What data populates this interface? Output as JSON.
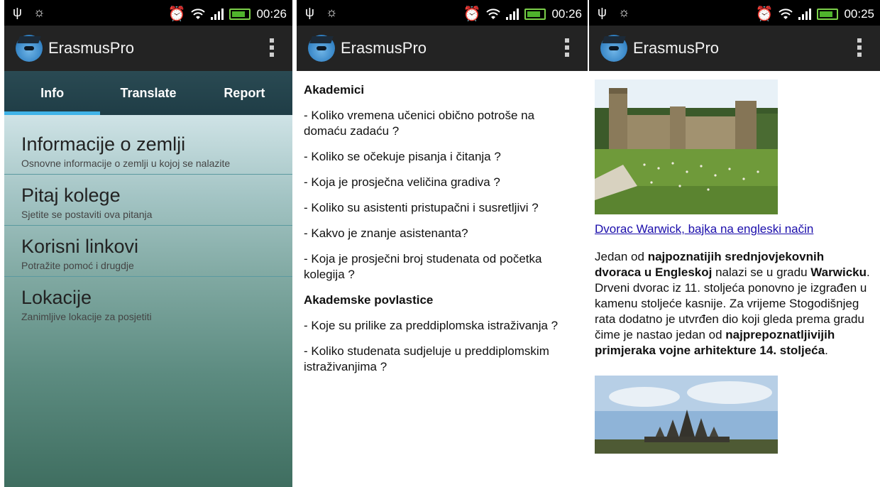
{
  "status_bars": [
    {
      "time": "00:26"
    },
    {
      "time": "00:26"
    },
    {
      "time": "00:25"
    }
  ],
  "app": {
    "title": "ErasmusPro"
  },
  "screen1": {
    "tabs": [
      {
        "label": "Info",
        "active": true
      },
      {
        "label": "Translate",
        "active": false
      },
      {
        "label": "Report",
        "active": false
      }
    ],
    "items": [
      {
        "title": "Informacije o zemlji",
        "subtitle": "Osnovne informacije o zemlji u kojoj se nalazite"
      },
      {
        "title": "Pitaj kolege",
        "subtitle": "Sjetite se postaviti ova pitanja"
      },
      {
        "title": "Korisni linkovi",
        "subtitle": "Potražite pomoć i drugdje"
      },
      {
        "title": "Lokacije",
        "subtitle": "Zanimljive lokacije za posjetiti"
      }
    ]
  },
  "screen2": {
    "heading1": "Akademici",
    "questions1": [
      "- Koliko vremena učenici obično potroše na domaću zadaću ?",
      "- Koliko se očekuje pisanja i čitanja ?",
      "- Koja je prosječna veličina gradiva ?",
      "- Koliko su asistenti pristupačni i susretljivi ?",
      "- Kakvo je znanje asistenanta?",
      "- Koja je prosječni broj studenata od početka kolegija ?"
    ],
    "heading2": "Akademske povlastice",
    "questions2": [
      "- Koje su prilike za preddiplomska istraživanja ?",
      "- Koliko studenata sudjeluje u preddiplomskim istraživanjima ?"
    ]
  },
  "screen3": {
    "link": "Dvorac Warwick, bajka na engleski način",
    "p_1": "Jedan od ",
    "b_1": "najpoznatijih srednjovjekovnih dvoraca u Engleskoj",
    "p_2": " nalazi se u gradu ",
    "b_2": "Warwicku",
    "p_3": ". Drveni dvorac iz 11. stoljeća ponovno je izgrađen u kamenu stoljeće kasnije. Za vrijeme Stogodišnjeg rata dodatno je utvrđen dio koji gleda prema gradu čime je nastao jedan od ",
    "b_3": "najprepoznatljivijih primjeraka vojne arhitekture 14. stoljeća",
    "p_4": "."
  }
}
